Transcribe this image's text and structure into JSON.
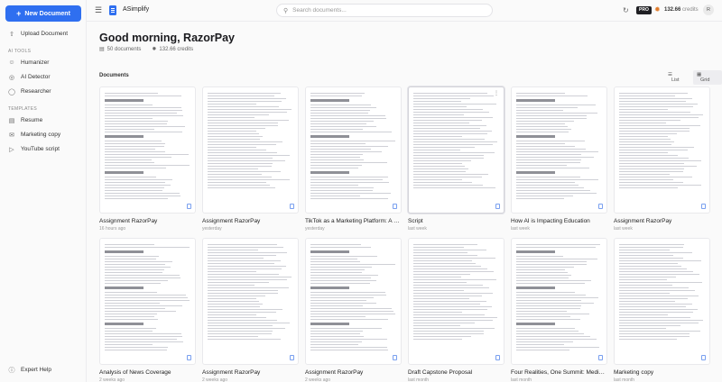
{
  "sidebar": {
    "new_doc_label": "New Document",
    "upload_label": "Upload Document",
    "ai_tools_label": "AI TOOLS",
    "ai_tools": [
      {
        "label": "Humanizer",
        "icon": "humanizer-icon"
      },
      {
        "label": "AI Detector",
        "icon": "detector-icon"
      },
      {
        "label": "Researcher",
        "icon": "researcher-icon"
      }
    ],
    "templates_label": "TEMPLATES",
    "templates": [
      {
        "label": "Resume",
        "icon": "resume-icon"
      },
      {
        "label": "Marketing copy",
        "icon": "marketing-icon"
      },
      {
        "label": "YouTube script",
        "icon": "youtube-icon"
      }
    ],
    "expert_help_label": "Expert Help"
  },
  "topbar": {
    "app_name": "ASimplify",
    "search_placeholder": "Search documents...",
    "pro_badge": "PRO",
    "credits_value": "132.66",
    "credits_label": "credits",
    "avatar_initial": "R"
  },
  "main": {
    "greeting": "Good morning, RazorPay",
    "documents_count": "50 documents",
    "credits_summary": "132.66 credits",
    "documents_label": "Documents",
    "view_list": "List",
    "view_grid": "Grid",
    "cards": [
      {
        "title": "Assignment RazorPay",
        "time": "16 hours ago"
      },
      {
        "title": "Assignment RazorPay",
        "time": "yesterday"
      },
      {
        "title": "TikTok as a Marketing Platform: A Stra...",
        "time": "yesterday"
      },
      {
        "title": "Script",
        "time": "last week"
      },
      {
        "title": "How AI is Impacting Education",
        "time": "last week"
      },
      {
        "title": "Assignment RazorPay",
        "time": "last week"
      },
      {
        "title": "Analysis of News Coverage",
        "time": "2 weeks ago"
      },
      {
        "title": "Assignment RazorPay",
        "time": "2 weeks ago"
      },
      {
        "title": "Assignment RazorPay",
        "time": "2 weeks ago"
      },
      {
        "title": "Draft Capstone Proposal",
        "time": "last month"
      },
      {
        "title": "Four Realities, One Summit: Media Fra...",
        "time": "last month"
      },
      {
        "title": "Marketing copy",
        "time": "last month"
      }
    ]
  },
  "colors": {
    "accent": "#2f6ff0",
    "credits_icon": "#e07b2a"
  }
}
